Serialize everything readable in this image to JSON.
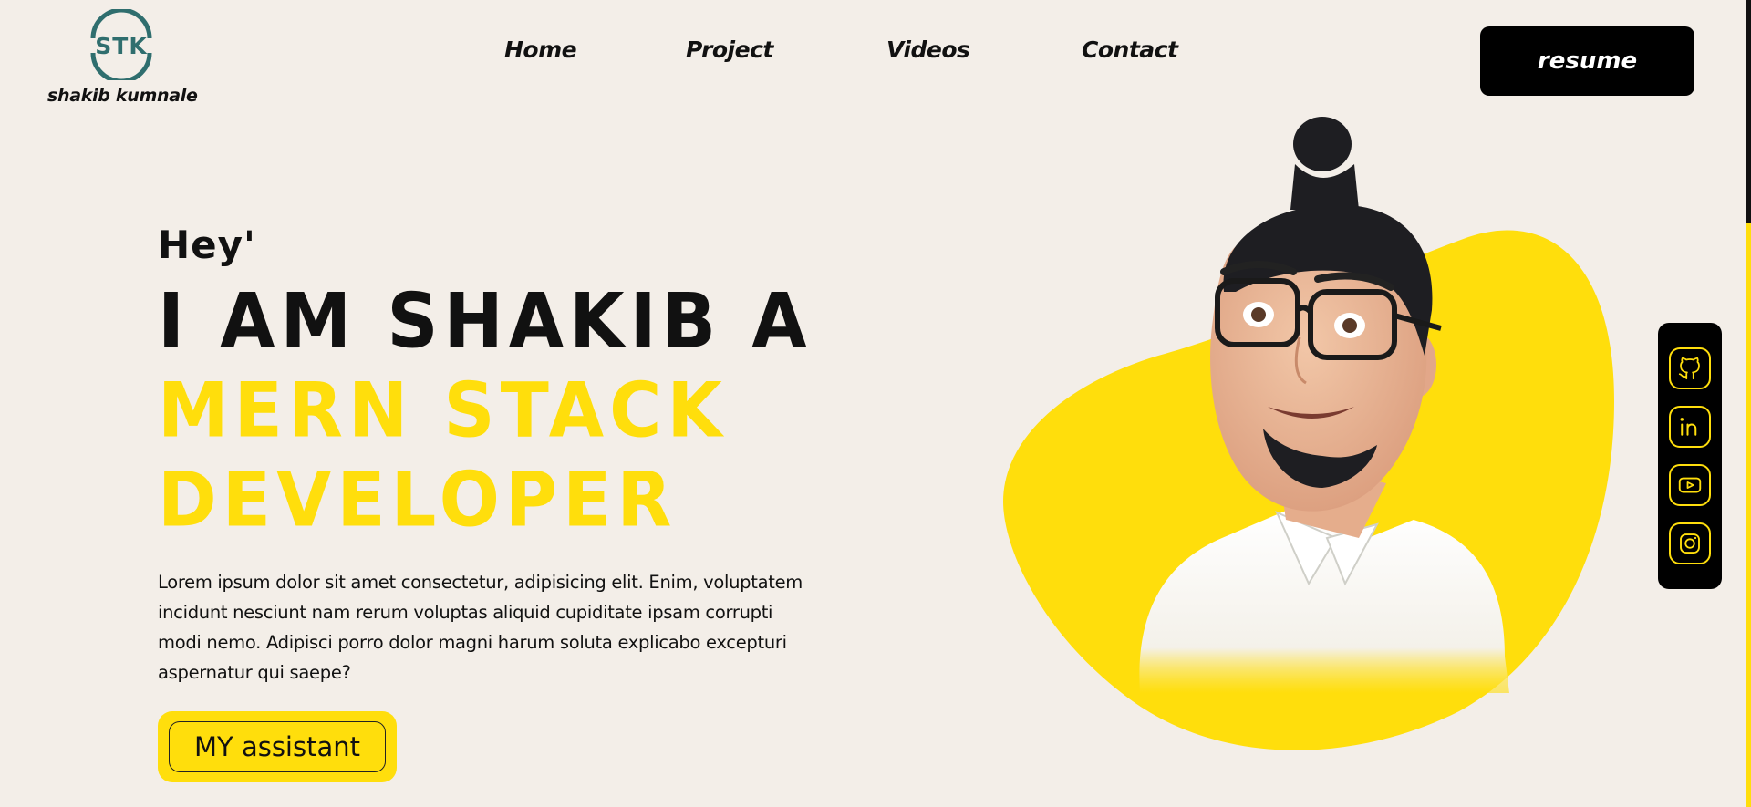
{
  "brand": {
    "logo_text": "STK",
    "name": "shakib kumnale"
  },
  "nav": {
    "items": [
      {
        "label": "Home"
      },
      {
        "label": "Project"
      },
      {
        "label": "Videos"
      },
      {
        "label": "Contact"
      }
    ],
    "resume_label": "resume"
  },
  "hero": {
    "greeting": "Hey'",
    "line1": "I AM SHAKIB A",
    "line2": "MERN STACK",
    "line3": "DEVELOPER",
    "description": "Lorem ipsum dolor sit amet consectetur, adipisicing elit. Enim, voluptatem incidunt nesciunt nam rerum voluptas aliquid cupiditate ipsam corrupti modi nemo. Adipisci porro dolor magni harum soluta explicabo excepturi aspernatur qui saepe?",
    "assistant_label": "MY assistant"
  },
  "social": {
    "items": [
      {
        "icon": "github-icon"
      },
      {
        "icon": "linkedin-icon"
      },
      {
        "icon": "youtube-icon"
      },
      {
        "icon": "instagram-icon"
      }
    ]
  },
  "colors": {
    "background": "#f3eee8",
    "accent": "#ffde0c",
    "dark": "#000000",
    "logo": "#2f6e6e"
  }
}
